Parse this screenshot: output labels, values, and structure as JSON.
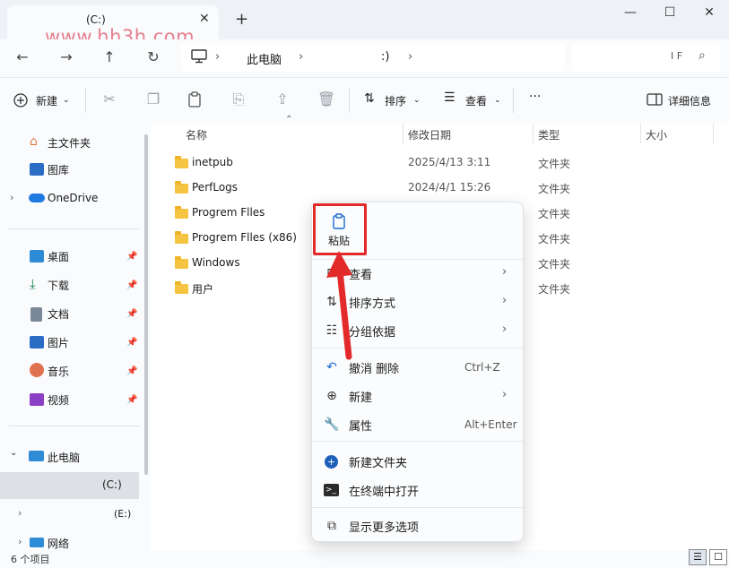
{
  "titlebar": {
    "tab_title": "(C:)",
    "tab_close": "✕",
    "new_tab": "+",
    "watermark": "www.hh3h.com",
    "minimize": "—",
    "maximize": "☐",
    "close": "✕"
  },
  "nav": {
    "back": "←",
    "forward": "→",
    "up": "↑",
    "refresh": "↻",
    "breadcrumb_pc": "此电脑",
    "breadcrumb_drive": ":)",
    "sep1": "›",
    "sep2": "›",
    "sep3": "›",
    "search_text": "I F",
    "search_icon": "⌕"
  },
  "toolbar": {
    "new_label": "新建",
    "sort_label": "排序",
    "view_label": "查看",
    "more_label": "···",
    "details_label": "详细信息"
  },
  "sidebar": {
    "items": [
      {
        "label": "主文件夹",
        "icon": "home-icon"
      },
      {
        "label": "图库",
        "icon": "gallery-icon"
      },
      {
        "label": "OneDrive",
        "icon": "cloud-icon"
      },
      {
        "label": "桌面",
        "icon": "desktop-icon"
      },
      {
        "label": "下载",
        "icon": "download-icon"
      },
      {
        "label": "文档",
        "icon": "document-icon"
      },
      {
        "label": "图片",
        "icon": "picture-icon"
      },
      {
        "label": "音乐",
        "icon": "music-icon"
      },
      {
        "label": "视频",
        "icon": "video-icon"
      },
      {
        "label": "此电脑",
        "icon": "pc-icon"
      },
      {
        "label": "(C:)",
        "icon": "drive-icon"
      },
      {
        "label": "(E:)",
        "icon": "drive-icon"
      },
      {
        "label": "网络",
        "icon": "network-icon"
      }
    ]
  },
  "columns": {
    "name": "名称",
    "date": "修改日期",
    "type": "类型",
    "size": "大小"
  },
  "files": [
    {
      "name": "inetpub",
      "date": "2025/4/13 3:11",
      "type": "文件夹"
    },
    {
      "name": "PerfLogs",
      "date": "2024/4/1 15:26",
      "type": "文件夹"
    },
    {
      "name": "Progrem Flles",
      "date": "",
      "type": "文件夹"
    },
    {
      "name": "Progrem Flles (x86)",
      "date": "",
      "type": "文件夹"
    },
    {
      "name": "Windows",
      "date": "",
      "type": "文件夹"
    },
    {
      "name": "用户",
      "date": "",
      "type": "文件夹"
    }
  ],
  "context_menu": {
    "paste": "粘贴",
    "items": [
      {
        "label": "查看",
        "icon": "grid-icon",
        "shortcut": "",
        "chevron": "›"
      },
      {
        "label": "排序方式",
        "icon": "sort-icon",
        "shortcut": "",
        "chevron": "›"
      },
      {
        "label": "分组依据",
        "icon": "group-icon",
        "shortcut": "",
        "chevron": "›"
      },
      {
        "label": "撤消 删除",
        "icon": "undo-icon",
        "shortcut": "Ctrl+Z",
        "chevron": ""
      },
      {
        "label": "新建",
        "icon": "new-icon",
        "shortcut": "",
        "chevron": "›"
      },
      {
        "label": "属性",
        "icon": "wrench-icon",
        "shortcut": "Alt+Enter",
        "chevron": ""
      },
      {
        "label": "新建文件夹",
        "icon": "new-folder-icon",
        "shortcut": "",
        "chevron": ""
      },
      {
        "label": "在终端中打开",
        "icon": "terminal-icon",
        "shortcut": "",
        "chevron": ""
      },
      {
        "label": "显示更多选项",
        "icon": "more-options-icon",
        "shortcut": "",
        "chevron": ""
      }
    ]
  },
  "status": {
    "count": "6 个项目"
  },
  "colors": {
    "highlight": "#e32a2a",
    "folder": "#f5c542",
    "accent": "#1a6ad0"
  }
}
